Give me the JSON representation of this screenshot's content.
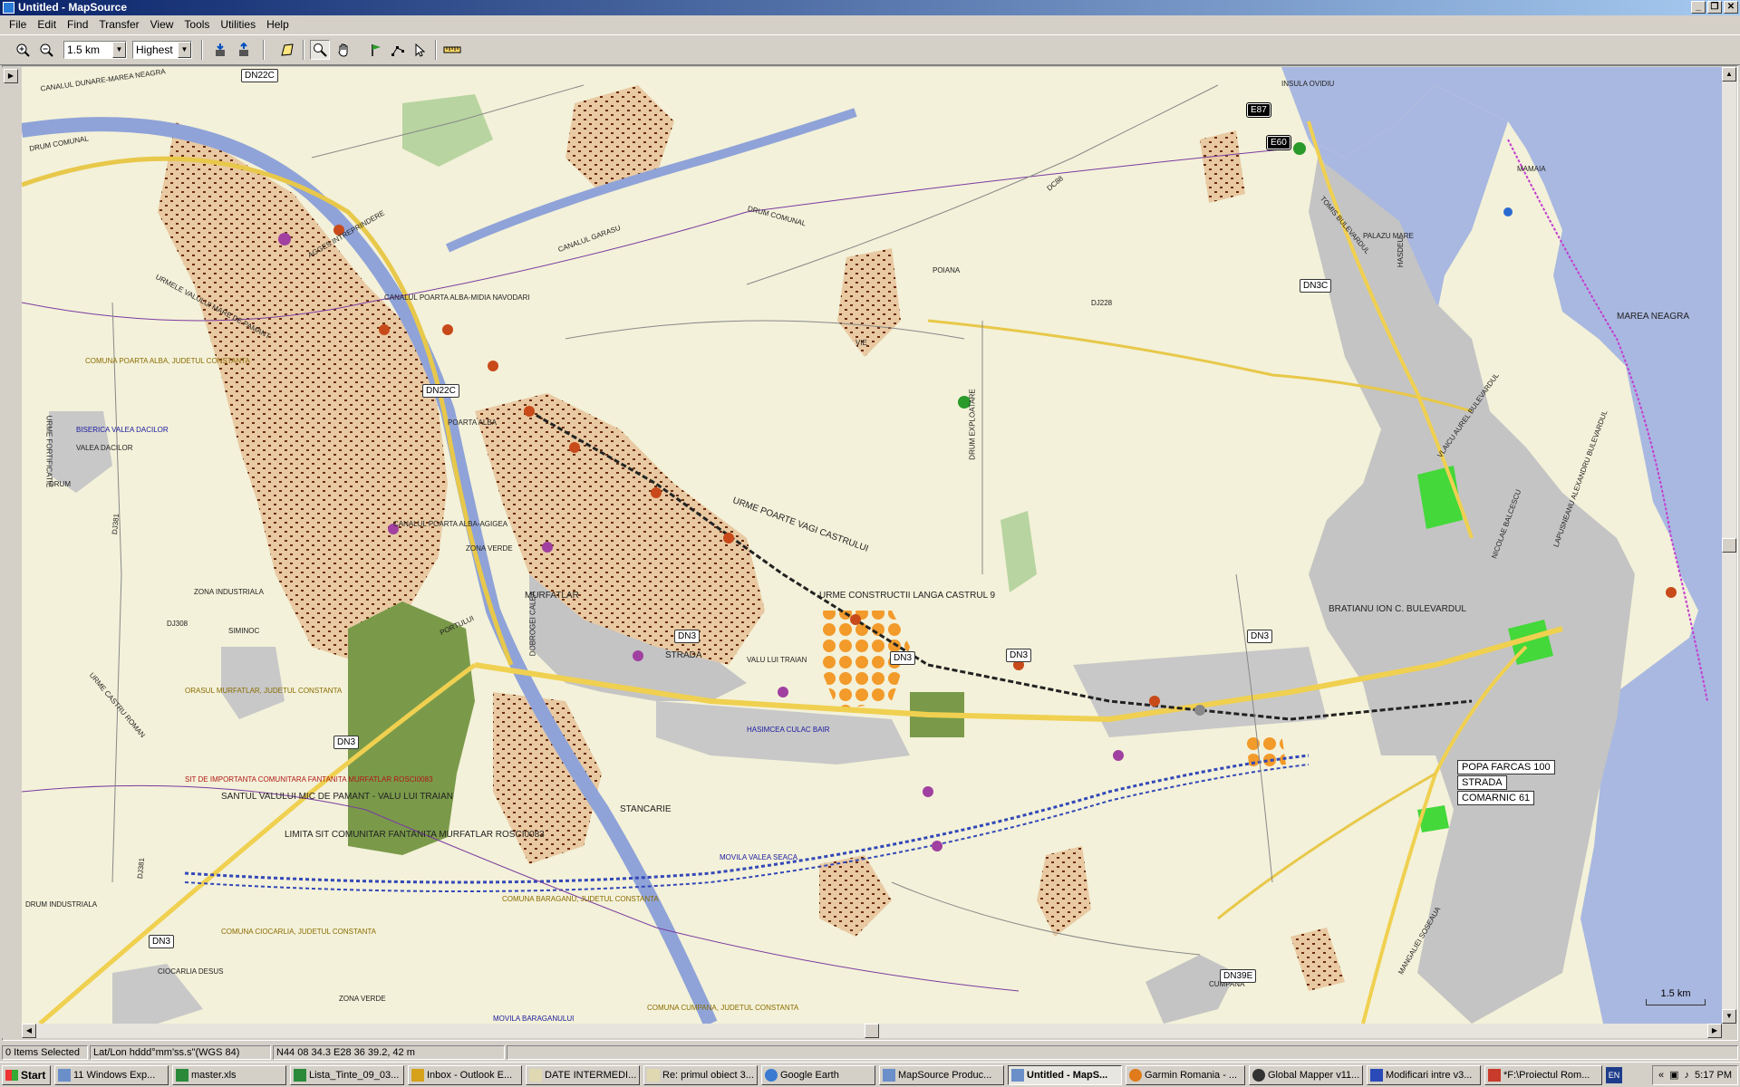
{
  "window": {
    "title": "Untitled - MapSource"
  },
  "menu": [
    "File",
    "Edit",
    "Find",
    "Transfer",
    "View",
    "Tools",
    "Utilities",
    "Help"
  ],
  "toolbar": {
    "zoom_value": "1.5 km",
    "detail_value": "Highest"
  },
  "map": {
    "labels": [
      "CANALUL DUNARE-MAREA NEAGRA",
      "DRUM COMUNAL",
      "URMELE VALULUI MARE DE PAMANT",
      "URME FORTIFICATIE",
      "COMUNA POARTA ALBA, JUDETUL CONSTANTA",
      "BISERICA VALEA DACILOR",
      "VALEA DACILOR",
      "DRUM",
      "POARTA ALBA",
      "CANALUL POARTA ALBA-MIDIA NAVODARI",
      "CANALUL POARTA ALBA-AGIGEA",
      "ZONA VERDE",
      "ZONA INDUSTRIALA",
      "SIMINOC",
      "ORASUL MURFATLAR, JUDETUL CONSTANTA",
      "URME CASTRU ROMAN",
      "MURFATLAR",
      "STRADA",
      "VALU LUI TRAIAN",
      "URME CONSTRUCTII LANGA CASTRUL 9",
      "URME POARTE VAGI CASTRULUI",
      "DRUM EXPLOATARE",
      "VIE",
      "POIANA",
      "INSULA OVIDIU",
      "TOMIS BULEVARDUL",
      "MAREA NEAGRA",
      "BRATIANU ION C. BULEVARDUL",
      "MAMAIA",
      "SANTUL VALULUI MIC DE PAMANT - VALU LUI TRAIAN",
      "LIMITA SIT COMUNITAR FANTANITA MURFATLAR ROSCI0083",
      "STANCARIE",
      "HASIMCEA CULAC BAIR",
      "MOVILA VALEA SEACA",
      "COMUNA BARAGANU, JUDETUL CONSTANTA",
      "COMUNA CIOCARLIA, JUDETUL CONSTANTA",
      "CIOCARLIA DESUS",
      "COMUNA CUMPANA, JUDETUL CONSTANTA",
      "MOVILA BARAGANULUI",
      "MANGALIEI SOSEAUA",
      "CUMPANA",
      "DRUM INDUSTRIALA",
      "ZONA VERDE",
      "VLAICU AUREL BULEVARDUL",
      "LAPUSNEANU ALEXANDRU BULEVARDUL",
      "PORTULUI",
      "SIT DE IMPORTANTA COMUNITARA FANTANITA MURFATLAR ROSCI0083",
      "PALAZU MARE",
      "HASDEU",
      "CANALUL GARASU",
      "DRUM COMUNAL",
      "AGGES INTREPRINDERE",
      "DOBROGEI CALEA",
      "NICOLAE BALCESCU"
    ],
    "shields": [
      "DN22C",
      "E87",
      "E60",
      "DN3C",
      "DN22C",
      "DN3",
      "DN3",
      "DN3",
      "DN3",
      "DN3",
      "DN39E",
      "DC88",
      "DJ228",
      "DJ308",
      "DJ381",
      "DN3",
      "DJ381"
    ],
    "callouts": [
      "POPA FARCAS 100",
      "STRADA",
      "COMARNIC 61"
    ],
    "scale_label": "1.5 km"
  },
  "status": {
    "selection": "0 Items Selected",
    "format": "Lat/Lon hddd°mm'ss.s\"(WGS 84)",
    "position": "N44 08 34.3 E28 36 39.2, 42 m"
  },
  "taskbar": {
    "start": "Start",
    "tasks": [
      "11 Windows Exp...",
      "master.xls",
      "Lista_Tinte_09_03...",
      "Inbox - Outlook E...",
      "DATE INTERMEDI...",
      "Re: primul obiect 3...",
      "Google Earth",
      "MapSource Produc...",
      "Untitled - MapS...",
      "Garmin Romania - ...",
      "Global Mapper v11...",
      "Modificari intre v3...",
      "*F:\\Proiectul Rom..."
    ],
    "lang": "EN",
    "clock": "5:17 PM"
  },
  "colors": {
    "title_bar": "#0a246a",
    "map_bg": "#f3f1d9",
    "water": "#a9b8e0",
    "canal": "#8fa3d8",
    "forest": "#7a9a4a",
    "vineyard": "#d8b48c",
    "urban": "#b4b4b4"
  }
}
